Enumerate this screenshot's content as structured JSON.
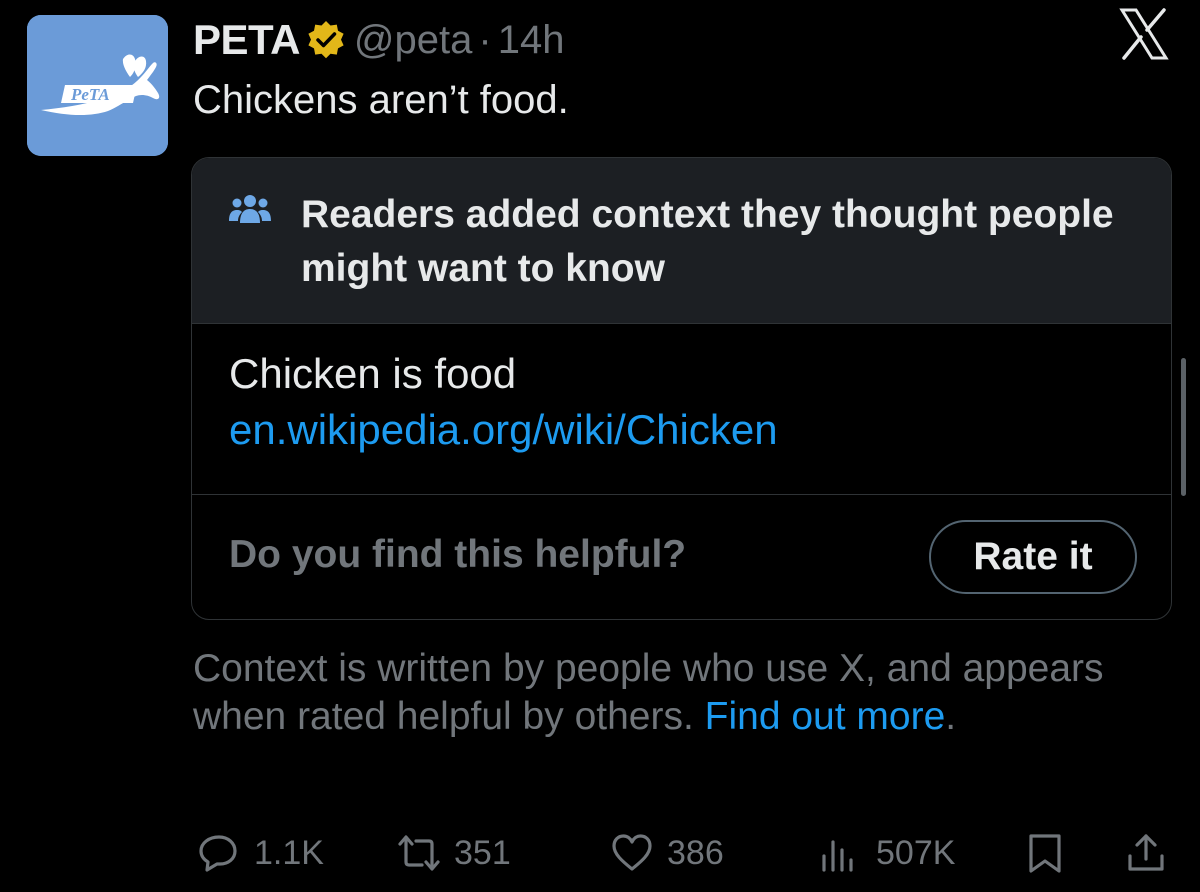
{
  "tweet": {
    "display_name": "PETA",
    "handle": "@peta",
    "separator": "·",
    "time": "14h",
    "text": "Chickens aren’t food.",
    "avatar_label": "PeTA"
  },
  "community_note": {
    "title": "Readers added context they thought people might want to know",
    "body": "Chicken is food",
    "link": "en.wikipedia.org/wiki/Chicken",
    "question": "Do you find this helpful?",
    "rate_button": "Rate it"
  },
  "context_footer": {
    "text": "Context is written by people who use X, and appears when rated helpful by others. ",
    "link": "Find out more",
    "period": "."
  },
  "actions": {
    "replies": "1.1K",
    "reposts": "351",
    "likes": "386",
    "views": "507K"
  },
  "icons": [
    "verified-badge-icon",
    "x-logo-icon",
    "people-icon",
    "reply-icon",
    "repost-icon",
    "like-icon",
    "views-icon",
    "bookmark-icon",
    "share-icon"
  ],
  "colors": {
    "background": "#000000",
    "link": "#1d9bf0",
    "muted": "#71767b",
    "badge_gold": "#e2b719",
    "avatar_blue": "#6b9bd8"
  }
}
